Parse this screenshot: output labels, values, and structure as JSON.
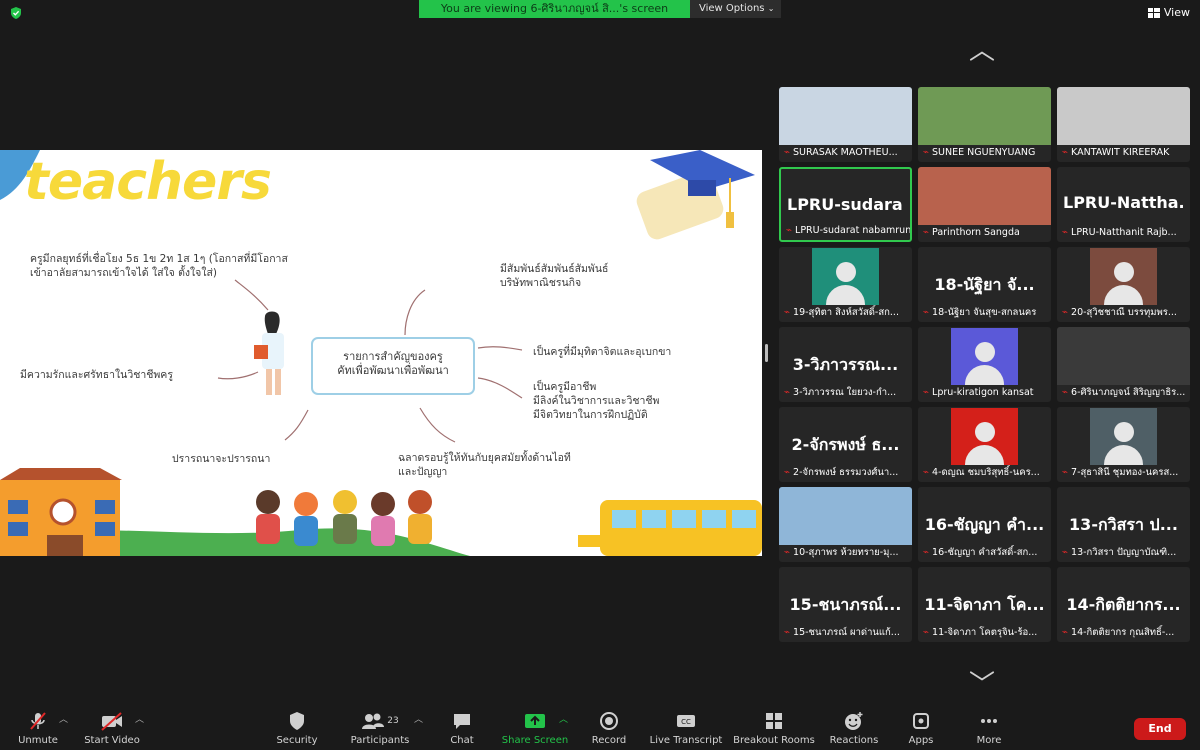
{
  "top_bar": {
    "viewing_text": "You are viewing 6-ศิรินาภญจน์ สิ...'s screen",
    "view_options_label": "View Options",
    "view_label": "View"
  },
  "slide": {
    "title_word": "teachers",
    "center_label": "รายการสำคัญของครู\nคัทเพื่อพัฒนาเพื่อพัฒนา",
    "items": [
      "ครูมีกลยุทธ์ที่เชื่อโยง 5ธ 1ข 2ท 1ส 1ๆ (โอกาสที่มีโอกาส\nเข้าอาลัยสามารถเข้าใจได้ ใส่ใจ ตั้งใจใส่)",
      "มีสัมพันธ์สัมพันธ์สัมพันธ์\nบริษัทพาณิชรนกิจ",
      "เป็นครูที่มีมุทิตาจิตและอุเบกขา",
      "เป็นครูมีอาชีพ\nมีลิงค์ในวิชาการและวิชาชีพ\nมีจิตวิทยาในการฝึกปฏิบัติ",
      "มีความรักและศรัทธาในวิชาชีพครู",
      "ปรารถนาจะปรารถนา",
      "ฉลาดรอบรู้ให้ทันกับยุคสมัยทั้งด้านไอที\nและปัญญา"
    ]
  },
  "participants": [
    {
      "tile_name": "",
      "label": "SURASAK MAOTHEU...",
      "type": "video",
      "color": "#c9d6e3"
    },
    {
      "tile_name": "",
      "label": "SUNEE NGUENYUANG",
      "type": "video",
      "color": "#6f9a55"
    },
    {
      "tile_name": "",
      "label": "KANTAWIT KIREERAK",
      "type": "video",
      "color": "#c9c9c9"
    },
    {
      "tile_name": "LPRU-sudara...",
      "label": "LPRU-sudarat nabamrung",
      "type": "name",
      "color": "#262626"
    },
    {
      "tile_name": "",
      "label": "Parinthorn Sangda",
      "type": "video",
      "color": "#b8624d"
    },
    {
      "tile_name": "LPRU-Nattha...",
      "label": "LPRU-Natthanit Rajb...",
      "type": "name",
      "color": "#262626"
    },
    {
      "tile_name": "",
      "label": "19-สุทิตา สิงห์สวัสดิ์-สก...",
      "type": "avatar",
      "color": "#1f8f7a"
    },
    {
      "tile_name": "18-นัฐิยา จั...",
      "label": "18-นัฐิยา จันสุข-สกลนคร",
      "type": "name",
      "color": "#262626"
    },
    {
      "tile_name": "",
      "label": "20-สุวิชชาณี บรรทุมพร...",
      "type": "avatar",
      "color": "#7c4b3e"
    },
    {
      "tile_name": "3-วิภาวรรณ...",
      "label": "3-วิภาวรรณ ใยยวง-กำ...",
      "type": "name",
      "color": "#262626"
    },
    {
      "tile_name": "",
      "label": "Lpru-kiratigon kansat",
      "type": "avatar",
      "color": "#5b59d8"
    },
    {
      "tile_name": "",
      "label": "6-ศิรินาภญจน์ สิริญญาธิร...",
      "type": "video",
      "color": "#3a3a3a"
    },
    {
      "tile_name": "2-จักรพงษ์ ธ...",
      "label": "2-จักรพงษ์ ธรรมวงศ์นา...",
      "type": "name",
      "color": "#262626"
    },
    {
      "tile_name": "",
      "label": "4-ดญณ ชมบริสุทธิ์-นคร...",
      "type": "avatar",
      "color": "#d4201a"
    },
    {
      "tile_name": "",
      "label": "7-สุธาสินี ชุมทอง-นครส...",
      "type": "avatar",
      "color": "#4f5f66"
    },
    {
      "tile_name": "",
      "label": "10-สุภาพร ห้วยทราย-มุ...",
      "type": "video",
      "color": "#8fb6d8"
    },
    {
      "tile_name": "16-ชัญญา คำ...",
      "label": "16-ชัญญา คำสวัสดิ์-สก...",
      "type": "name",
      "color": "#262626"
    },
    {
      "tile_name": "13-กวิสรา ป...",
      "label": "13-กวิสรา ปัญญาบัณฑิ...",
      "type": "name",
      "color": "#262626"
    },
    {
      "tile_name": "15-ชนาภรณ์...",
      "label": "15-ชนาภรณ์ ผาด่านแก้...",
      "type": "name",
      "color": "#262626"
    },
    {
      "tile_name": "11-จิดาภา โค...",
      "label": "11-จิดาภา โคตรุจิน-ร้อ...",
      "type": "name",
      "color": "#262626"
    },
    {
      "tile_name": "14-กิตติยากร...",
      "label": "14-กิตติยากร กุณสิทธิ์-...",
      "type": "name",
      "color": "#262626"
    }
  ],
  "toolbar": {
    "unmute": "Unmute",
    "start_video": "Start Video",
    "security": "Security",
    "participants": "Participants",
    "participants_count": "23",
    "chat": "Chat",
    "share_screen": "Share Screen",
    "record": "Record",
    "live_transcript": "Live Transcript",
    "breakout_rooms": "Breakout Rooms",
    "reactions": "Reactions",
    "apps": "Apps",
    "more": "More",
    "end": "End"
  },
  "colors": {
    "accent_green": "#23c34a",
    "end_red": "#cc1a1a",
    "muted_red": "#e02828"
  }
}
